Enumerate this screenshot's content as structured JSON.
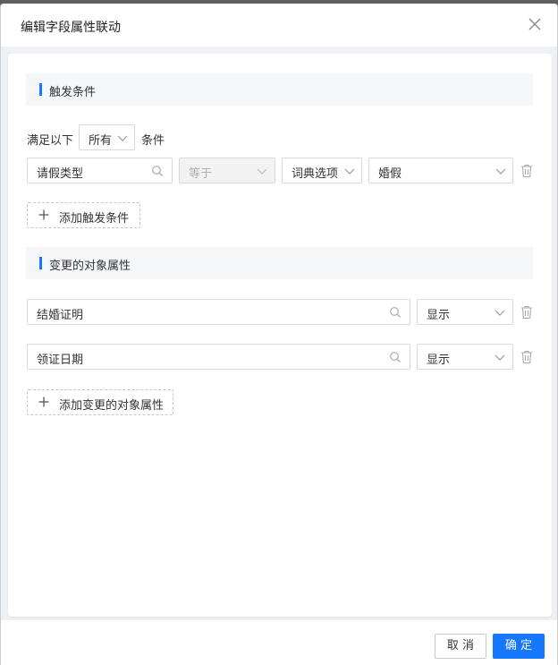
{
  "dialog": {
    "title": "编辑字段属性联动"
  },
  "trigger_section": {
    "heading": "触发条件",
    "match_prefix": "满足以下",
    "match_mode": "所有",
    "match_suffix": "条件",
    "condition": {
      "field": "请假类型",
      "operator": "等于",
      "value_type": "词典选项",
      "value": "婚假"
    },
    "add_label": "添加触发条件"
  },
  "target_section": {
    "heading": "变更的对象属性",
    "rows": [
      {
        "field": "结婚证明",
        "action": "显示"
      },
      {
        "field": "领证日期",
        "action": "显示"
      }
    ],
    "add_label": "添加变更的对象属性"
  },
  "footer": {
    "cancel_label": "取 消",
    "ok_label": "确 定"
  },
  "colors": {
    "primary": "#1677ff",
    "section_bg": "#f5f6f8"
  }
}
